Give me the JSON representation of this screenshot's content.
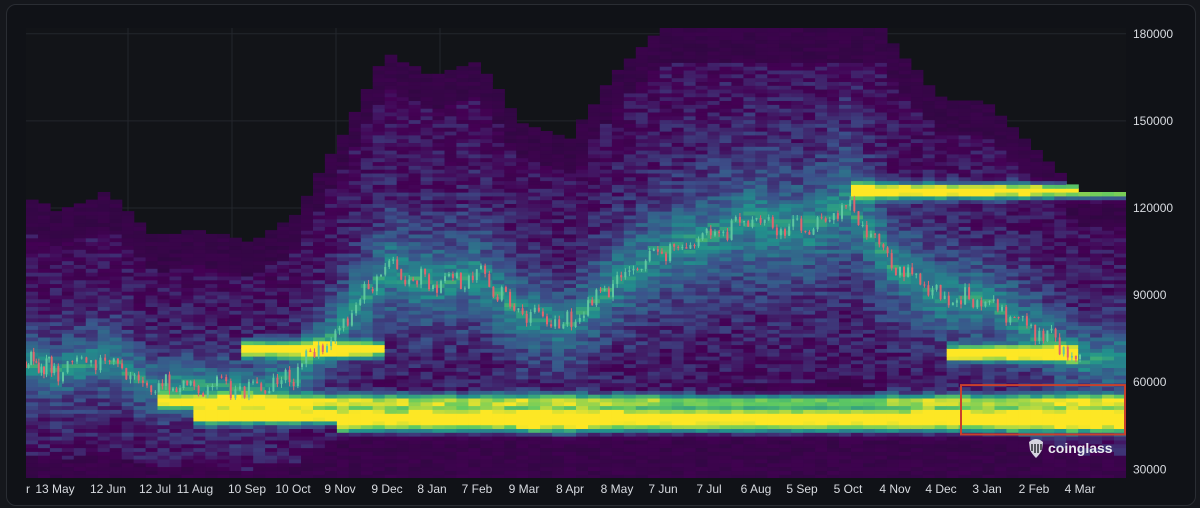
{
  "chart_data": {
    "type": "heatmap",
    "title": "",
    "xlabel": "",
    "ylabel": "",
    "ylim": [
      27000,
      182000
    ],
    "y_ticks": [
      180000,
      150000,
      120000,
      90000,
      60000,
      30000
    ],
    "y_tick_labels": [
      "180000",
      "150000",
      "120000",
      "90000",
      "60000",
      "30000"
    ],
    "x_tick_labels": [
      "r",
      "13 May",
      "12 Jun",
      "12 Jul",
      "11 Aug",
      "10 Sep",
      "10 Oct",
      "9 Nov",
      "9 Dec",
      "8 Jan",
      "7 Feb",
      "9 Mar",
      "8 Apr",
      "8 May",
      "7 Jun",
      "7 Jul",
      "6 Aug",
      "5 Sep",
      "5 Oct",
      "4 Nov",
      "4 Dec",
      "3 Jan",
      "2 Feb",
      "4 Mar"
    ],
    "grid": true,
    "colorscale": [
      "#2a0a3c",
      "#440154",
      "#3b528b",
      "#21918c",
      "#5ec962",
      "#fde725"
    ],
    "price_series": {
      "name": "",
      "color": "#e0656e",
      "points": [
        {
          "x": "r",
          "y": 67000
        },
        {
          "x": "13 May",
          "y": 64000
        },
        {
          "x": "12 Jun",
          "y": 68000
        },
        {
          "x": "12 Jul",
          "y": 58000
        },
        {
          "x": "11 Aug",
          "y": 60000
        },
        {
          "x": "10 Sep",
          "y": 57000
        },
        {
          "x": "10 Oct",
          "y": 62000
        },
        {
          "x": "9 Nov",
          "y": 80000
        },
        {
          "x": "9 Dec",
          "y": 99000
        },
        {
          "x": "8 Jan",
          "y": 94000
        },
        {
          "x": "7 Feb",
          "y": 97000
        },
        {
          "x": "9 Mar",
          "y": 83000
        },
        {
          "x": "8 Apr",
          "y": 80000
        },
        {
          "x": "8 May",
          "y": 95000
        },
        {
          "x": "7 Jun",
          "y": 105000
        },
        {
          "x": "7 Jul",
          "y": 110000
        },
        {
          "x": "6 Aug",
          "y": 116000
        },
        {
          "x": "5 Sep",
          "y": 112000
        },
        {
          "x": "5 Oct",
          "y": 121000
        },
        {
          "x": "4 Nov",
          "y": 100000
        },
        {
          "x": "4 Dec",
          "y": 89000
        },
        {
          "x": "3 Jan",
          "y": 88000
        },
        {
          "x": "2 Feb",
          "y": 78000
        },
        {
          "x": "4 Mar",
          "y": 68000
        }
      ]
    },
    "liquidation_bands": [
      {
        "price": 126000,
        "intensity": 1.0,
        "from": "5 Oct",
        "to": "4 Mar"
      },
      {
        "price": 71500,
        "intensity": 0.95,
        "from": "10 Sep",
        "to": "9 Nov"
      },
      {
        "price": 70000,
        "intensity": 1.0,
        "from": "4 Dec",
        "to": "2 Feb"
      },
      {
        "price": 48500,
        "intensity": 1.0,
        "from": "11 Aug",
        "to": "4 Mar"
      },
      {
        "price": 53500,
        "intensity": 0.75,
        "from": "12 Jul",
        "to": "4 Mar"
      },
      {
        "price": 45000,
        "intensity": 0.7,
        "from": "9 Nov",
        "to": "4 Mar"
      }
    ],
    "annotations": [
      {
        "type": "highlight-box",
        "y_range": [
          42000,
          59000
        ],
        "x_range": [
          "3 Jan",
          "4 Mar"
        ],
        "color": "#c9402c"
      }
    ]
  },
  "watermark": {
    "text": "coinglass",
    "icon": "coinglass-logo-icon"
  }
}
